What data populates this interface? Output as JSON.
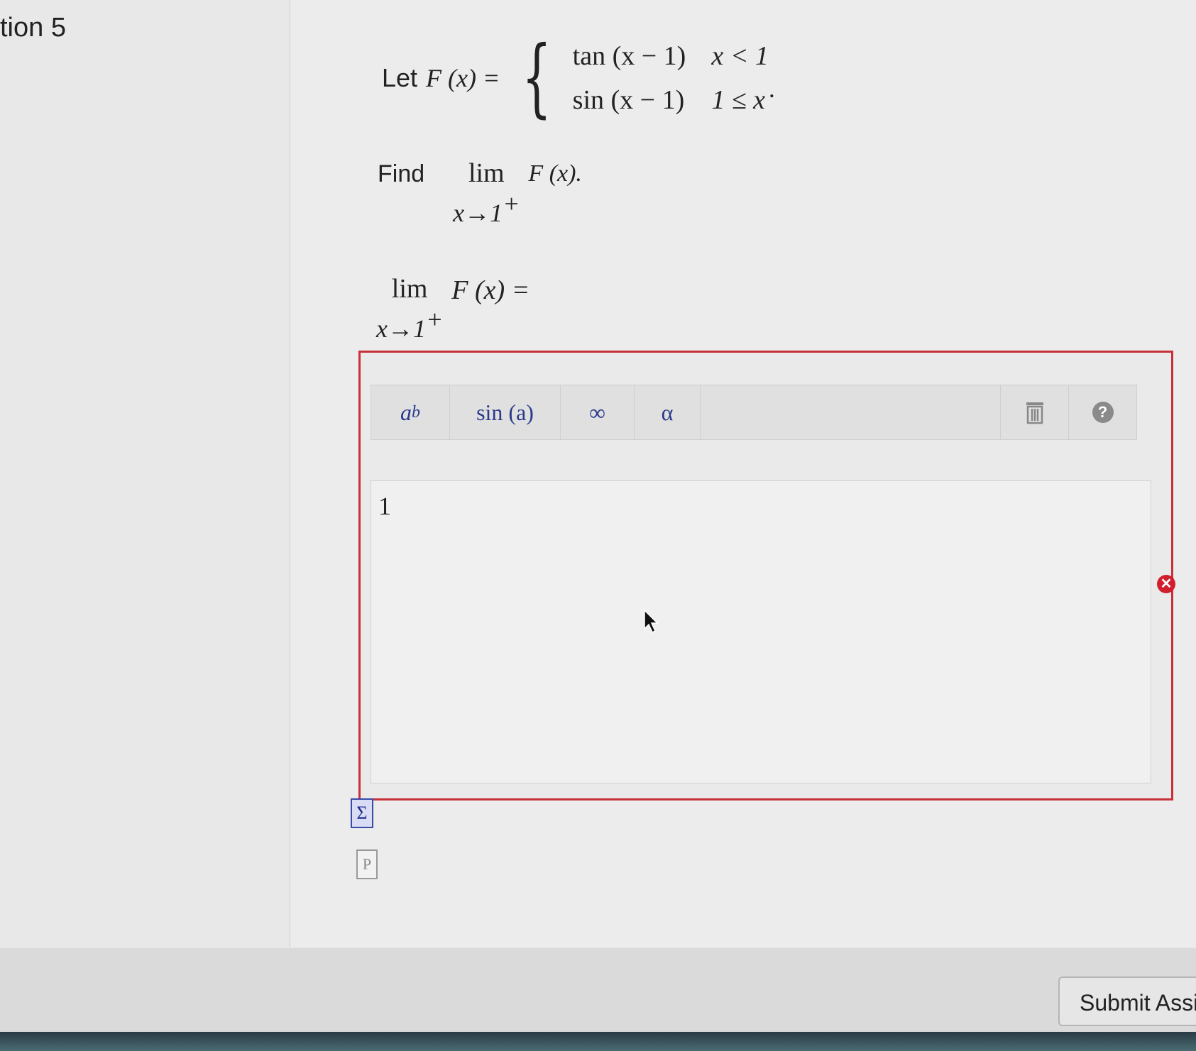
{
  "question": {
    "label": "tion 5",
    "let_prefix": "Let",
    "function_name": "F (x) =",
    "cases": [
      {
        "expr": "tan (x − 1)",
        "condition": "x < 1"
      },
      {
        "expr": "sin (x − 1)",
        "condition": "1 ≤ x"
      }
    ],
    "trailing_dot": ".",
    "find_prefix": "Find",
    "lim_word": "lim",
    "lim_sub": "x→1",
    "lim_sup": "+",
    "find_function": "F (x).",
    "answer_function": "F (x) ="
  },
  "toolbar": {
    "power_base": "a",
    "power_exp": "b",
    "sin_label": "sin (a)",
    "infinity_label": "∞",
    "alpha_label": "α",
    "trash_icon": "trash-icon",
    "help_label": "?"
  },
  "answer": {
    "value": "1",
    "status": "incorrect",
    "error_mark": "✕"
  },
  "side_icons": {
    "sigma": "Σ",
    "doc": "P"
  },
  "submit": {
    "label": "Submit Assig"
  },
  "colors": {
    "error_border": "#c8303a",
    "error_icon": "#d21f2d",
    "sigma_icon": "#3a4aa8"
  }
}
